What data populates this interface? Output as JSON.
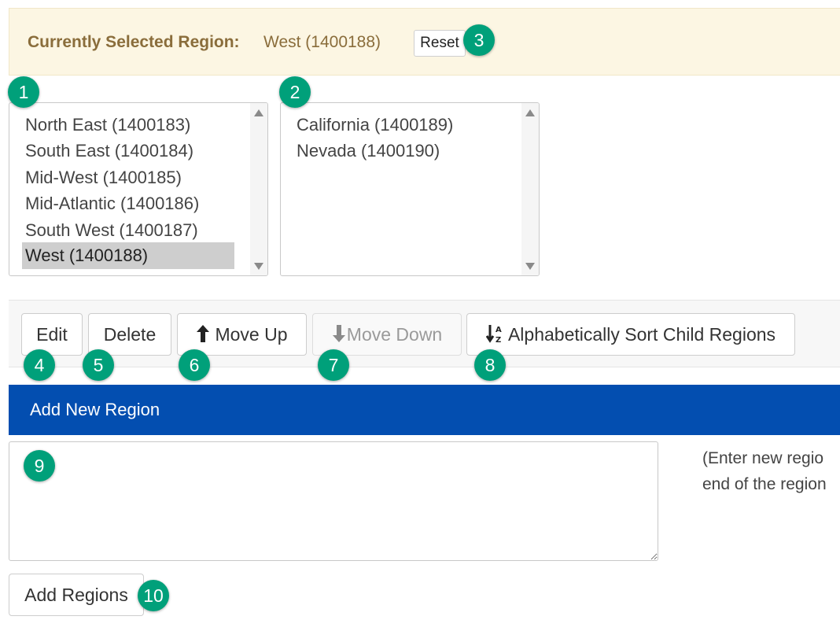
{
  "banner": {
    "label": "Currently Selected Region:",
    "value": "West (1400188)",
    "reset_label": "Reset"
  },
  "regions": [
    "North East (1400183)",
    "South East (1400184)",
    "Mid-West (1400185)",
    "Mid-Atlantic (1400186)",
    "South West (1400187)",
    "West (1400188)"
  ],
  "selected_region": "West (1400188)",
  "child_regions": [
    "California (1400189)",
    "Nevada (1400190)"
  ],
  "toolbar": {
    "edit": "Edit",
    "delete": "Delete",
    "move_up": "Move Up",
    "move_down": "Move Down",
    "sort": "Alphabetically Sort Child Regions"
  },
  "add_section": {
    "title": "Add New Region",
    "textarea_value": "",
    "help_line1": "(Enter new regio",
    "help_line2": "end of the region",
    "add_button": "Add Regions"
  },
  "callouts": [
    "1",
    "2",
    "3",
    "4",
    "5",
    "6",
    "7",
    "8",
    "9",
    "10"
  ],
  "colors": {
    "badge": "#00a07a",
    "header_blue": "#034eb0",
    "banner_bg": "#fcf6e3",
    "banner_text": "#8a6d3b",
    "selected_bg": "#cecece"
  }
}
